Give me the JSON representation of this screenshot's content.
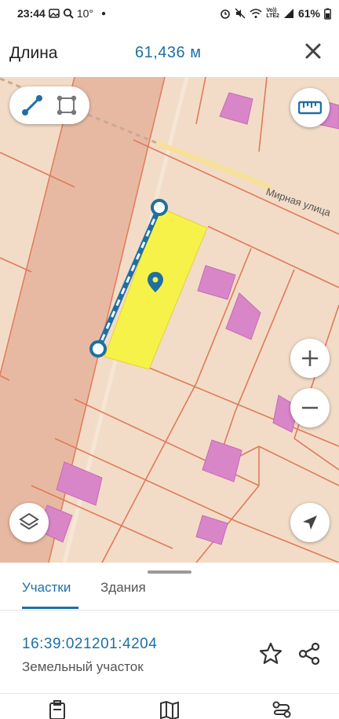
{
  "status_bar": {
    "time": "23:44",
    "weather": "10°",
    "battery": "61%",
    "network_label": "Vo))\nLTE2",
    "icons": [
      "gallery-icon",
      "search-icon",
      "dot-icon",
      "alarm-icon",
      "mute-icon",
      "wifi-icon",
      "signal-icon",
      "battery-icon"
    ]
  },
  "header": {
    "title": "Длина",
    "value": "61,436 м",
    "close_icon": "close-icon"
  },
  "map": {
    "street_label": "Мирная улица",
    "colors": {
      "background": "#f2dcc8",
      "road": "#e6b8a0",
      "parcel_line": "#e07a5a",
      "building": "#d882c8",
      "selection": "#f7f24a",
      "measure_line": "#1f6fa3"
    },
    "controls": [
      "line-tool-icon",
      "polygon-tool-icon",
      "ruler-icon",
      "zoom-in-icon",
      "zoom-out-icon",
      "layers-icon",
      "locate-arrow-icon"
    ]
  },
  "sheet": {
    "tabs": [
      {
        "label": "Участки",
        "active": true
      },
      {
        "label": "Здания",
        "active": false
      }
    ],
    "parcel_id": "16:39:021201:4204",
    "parcel_type": "Земельный участок",
    "actions": [
      "star-icon",
      "share-icon"
    ]
  },
  "bottom_nav": {
    "icons": [
      "clipboard-icon",
      "map-icon",
      "route-icon"
    ]
  }
}
